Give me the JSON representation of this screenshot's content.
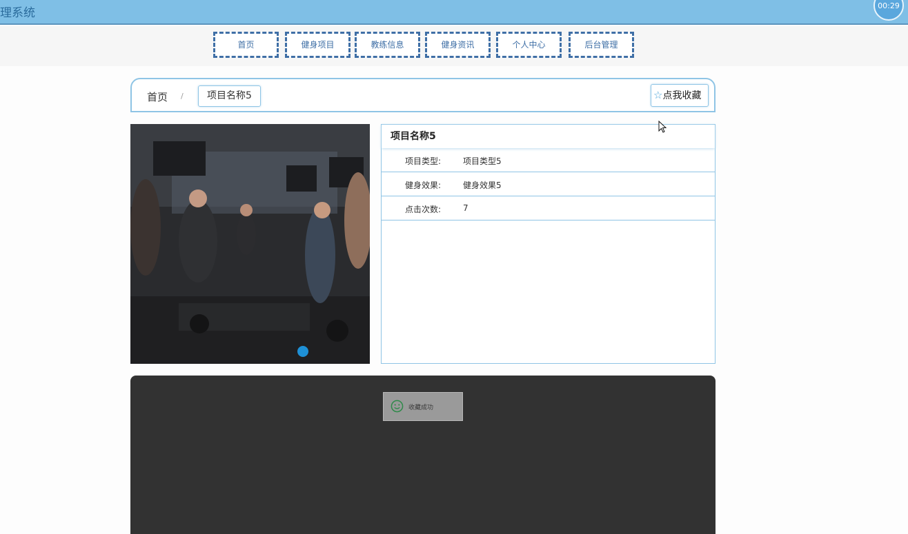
{
  "header": {
    "site_title": "理系统",
    "timer": "00:29"
  },
  "nav": {
    "items": [
      {
        "label": "首页"
      },
      {
        "label": "健身项目"
      },
      {
        "label": "教练信息"
      },
      {
        "label": "健身资讯"
      },
      {
        "label": "个人中心"
      },
      {
        "label": "后台管理"
      }
    ]
  },
  "breadcrumb": {
    "home": "首页",
    "separator": "/",
    "current": "项目名称5"
  },
  "favorite": {
    "label": "点我收藏",
    "icon": "star-outline-icon"
  },
  "detail": {
    "title": "项目名称5",
    "rows": [
      {
        "label": "项目类型:",
        "value": "项目类型5"
      },
      {
        "label": "健身效果:",
        "value": "健身效果5"
      },
      {
        "label": "点击次数:",
        "value": "7"
      }
    ]
  },
  "toast": {
    "icon": "smile-icon",
    "text": "收藏成功"
  },
  "colors": {
    "topbar": "#7fbfe6",
    "nav_border": "#3f6fa6",
    "panel_border": "#8ec4e5",
    "dark_panel": "#323232"
  }
}
